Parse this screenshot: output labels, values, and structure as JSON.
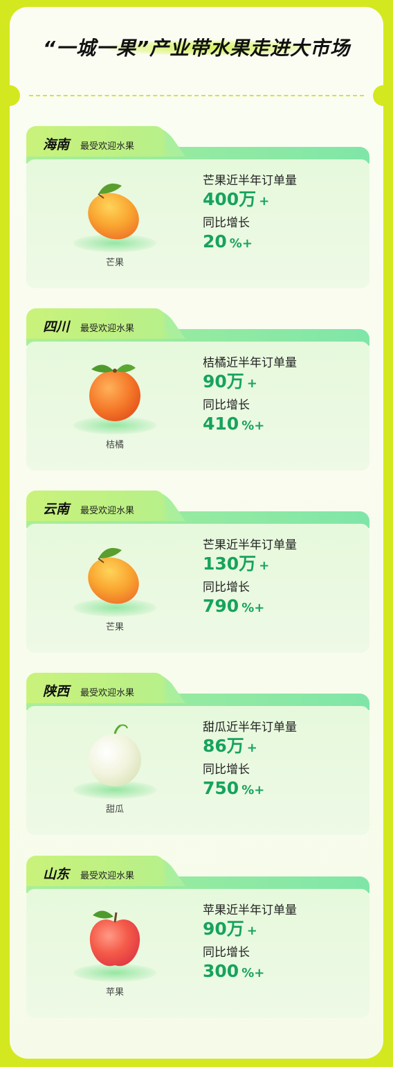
{
  "title": "“一城一果”产业带水果走进大市场",
  "subtitle_label": "最受欢迎水果",
  "growth_label": "同比增长",
  "regions": [
    {
      "name": "海南",
      "fruit": "芒果",
      "orders_label": "芒果近半年订单量",
      "orders_value": "400万",
      "orders_suffix": "+",
      "growth_value": "20",
      "growth_suffix": "%+"
    },
    {
      "name": "四川",
      "fruit": "桔橘",
      "orders_label": "桔橘近半年订单量",
      "orders_value": "90万",
      "orders_suffix": "+",
      "growth_value": "410",
      "growth_suffix": "%+"
    },
    {
      "name": "云南",
      "fruit": "芒果",
      "orders_label": "芒果近半年订单量",
      "orders_value": "130万",
      "orders_suffix": "+",
      "growth_value": "790",
      "growth_suffix": "%+"
    },
    {
      "name": "陕西",
      "fruit": "甜瓜",
      "orders_label": "甜瓜近半年订单量",
      "orders_value": "86万",
      "orders_suffix": "+",
      "growth_value": "750",
      "growth_suffix": "%+"
    },
    {
      "name": "山东",
      "fruit": "苹果",
      "orders_label": "苹果近半年订单量",
      "orders_value": "90万",
      "orders_suffix": "+",
      "growth_value": "300",
      "growth_suffix": "%+"
    }
  ],
  "icons": [
    "mango-icon",
    "tangerine-icon",
    "mango-icon",
    "melon-icon",
    "apple-icon"
  ],
  "colors": {
    "background": "#d4e81f",
    "accent_green": "#17a35c",
    "tab_green": "#a9ee9a"
  }
}
